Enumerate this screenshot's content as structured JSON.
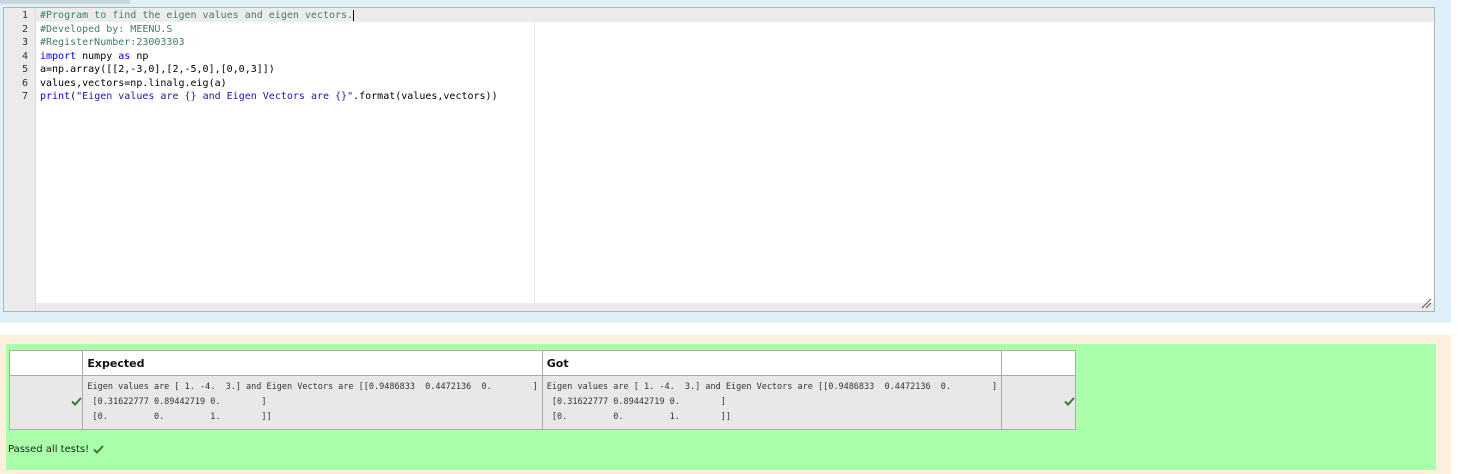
{
  "editor": {
    "line_numbers": [
      "1",
      "2",
      "3",
      "4",
      "5",
      "6",
      "7"
    ],
    "lines": [
      {
        "tokens": [
          {
            "t": "#Program to find the eigen values and eigen vectors.",
            "k": "comment"
          }
        ]
      },
      {
        "tokens": [
          {
            "t": "#Developed by: MEENU.S",
            "k": "comment"
          }
        ]
      },
      {
        "tokens": [
          {
            "t": "#RegisterNumber:23003303",
            "k": "comment"
          }
        ]
      },
      {
        "tokens": [
          {
            "t": "import",
            "k": "kw"
          },
          {
            "t": " numpy ",
            "k": "text"
          },
          {
            "t": "as",
            "k": "kw"
          },
          {
            "t": " np",
            "k": "text"
          }
        ]
      },
      {
        "tokens": [
          {
            "t": "a=np.array([[2,-3,0],[2,-5,0],[0,0,3]])",
            "k": "text"
          }
        ]
      },
      {
        "tokens": [
          {
            "t": "values,vectors=np.linalg.eig(a)",
            "k": "text"
          }
        ]
      },
      {
        "tokens": [
          {
            "t": "print",
            "k": "kw"
          },
          {
            "t": "(",
            "k": "text"
          },
          {
            "t": "\"Eigen values are {} and Eigen Vectors are {}\"",
            "k": "str"
          },
          {
            "t": ".format(values,vectors))",
            "k": "text"
          }
        ]
      }
    ]
  },
  "results": {
    "headers": {
      "expected": "Expected",
      "got": "Got"
    },
    "rows": [
      {
        "status": "pass",
        "expected": "Eigen values are [ 1. -4.  3.] and Eigen Vectors are [[0.9486833  0.4472136  0.        ]\n [0.31622777 0.89442719 0.        ]\n [0.         0.         1.        ]]",
        "got": "Eigen values are [ 1. -4.  3.] and Eigen Vectors are [[0.9486833  0.4472136  0.        ]\n [0.31622777 0.89442719 0.        ]\n [0.         0.         1.        ]]"
      }
    ],
    "summary": "Passed all tests!"
  },
  "colors": {
    "answer_bg": "#dff0f7",
    "results_bg": "#aaffaa",
    "outer_results_bg": "#fcefdc",
    "check_green": "#3c763d"
  },
  "icons": {
    "row_status_left": "check-icon",
    "row_status_right": "check-icon",
    "summary": "check-icon",
    "resize": "resize-grip-icon"
  }
}
